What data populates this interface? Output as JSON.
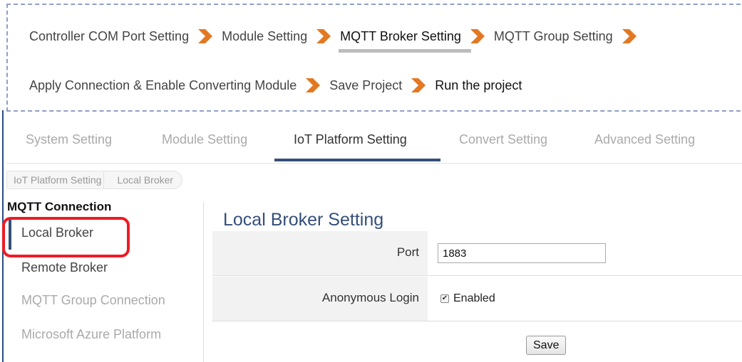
{
  "wizard": {
    "steps_row1": [
      {
        "label": "Controller COM Port Setting"
      },
      {
        "label": "Module Setting"
      },
      {
        "label": "MQTT Broker Setting"
      },
      {
        "label": "MQTT Group Setting"
      }
    ],
    "steps_row2": [
      {
        "label": "Apply Connection & Enable Converting Module"
      },
      {
        "label": "Save Project"
      },
      {
        "label": "Run the project"
      }
    ],
    "active_step": "MQTT Broker Setting",
    "arrow_icon": "chevron-right-icon",
    "arrow_color": "#e37823"
  },
  "tabs": [
    {
      "label": "System Setting"
    },
    {
      "label": "Module Setting"
    },
    {
      "label": "IoT Platform Setting"
    },
    {
      "label": "Convert Setting"
    },
    {
      "label": "Advanced Setting"
    }
  ],
  "active_tab": "IoT Platform Setting",
  "breadcrumb": [
    "IoT Platform Setting",
    "Local Broker"
  ],
  "sidebar": {
    "title": "MQTT Connection",
    "items": [
      {
        "label": "Local Broker"
      },
      {
        "label": "Remote Broker"
      },
      {
        "label": "MQTT Group Connection"
      },
      {
        "label": "Microsoft Azure Platform"
      }
    ],
    "active_item": "Local Broker"
  },
  "main": {
    "title": "Local Broker Setting",
    "port_label": "Port",
    "port_value": "1883",
    "anon_label": "Anonymous Login",
    "anon_checkbox_label": "Enabled",
    "anon_checked": true,
    "save_label": "Save"
  },
  "colors": {
    "accent": "#344f7a",
    "highlight": "#ec1c24",
    "wizard_border": "#8f9fc6"
  }
}
